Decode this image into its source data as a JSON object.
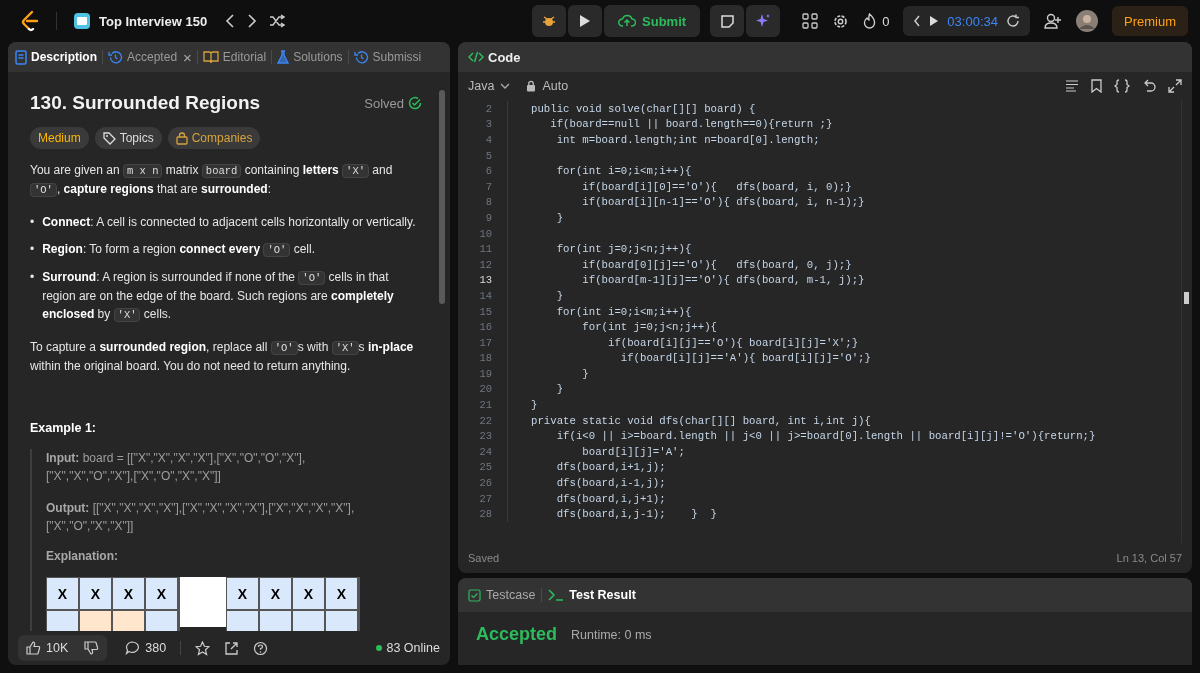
{
  "topbar": {
    "list_title": "Top Interview 150",
    "submit": "Submit",
    "streak": "0",
    "timer": "03:00:34",
    "premium": "Premium"
  },
  "left_tabs": [
    {
      "label": "Description",
      "selected": true,
      "closable": false
    },
    {
      "label": "Accepted",
      "selected": false,
      "closable": true
    },
    {
      "label": "Editorial",
      "selected": false,
      "closable": false
    },
    {
      "label": "Solutions",
      "selected": false,
      "closable": false
    },
    {
      "label": "Submissi",
      "selected": false,
      "closable": false
    }
  ],
  "close_glyph": "×",
  "problem": {
    "title": "130. Surrounded Regions",
    "status": "Solved",
    "tags": [
      {
        "label": "Medium",
        "kind": "difficulty",
        "color": "#ffb800"
      },
      {
        "label": "Topics",
        "kind": "topics",
        "color": "#dddddd"
      },
      {
        "label": "Companies",
        "kind": "companies",
        "color": "#d8a33b"
      }
    ],
    "description": [
      {
        "kind": "paragraph",
        "parts": [
          {
            "kind": "text",
            "text": "You are given an "
          },
          {
            "kind": "code",
            "text": "m x n"
          },
          {
            "kind": "text",
            "text": " matrix "
          },
          {
            "kind": "code",
            "text": "board"
          },
          {
            "kind": "text",
            "text": " containing **letters** "
          },
          {
            "kind": "code",
            "text": "'X'"
          },
          {
            "kind": "text",
            "text": " and "
          },
          {
            "kind": "code",
            "text": "'O'"
          },
          {
            "kind": "text",
            "text": ", **capture regions** that are **surrounded**:"
          }
        ]
      },
      {
        "kind": "bullets",
        "marker": "•",
        "items": [
          {
            "parts": [
              {
                "kind": "text",
                "text": "**Connect**: A cell is connected to adjacent cells horizontally or vertically."
              }
            ]
          },
          {
            "parts": [
              {
                "kind": "text",
                "text": "**Region**: To form a region **connect every** "
              },
              {
                "kind": "code",
                "text": "'O'"
              },
              {
                "kind": "text",
                "text": " cell."
              }
            ]
          },
          {
            "parts": [
              {
                "kind": "text",
                "text": "**Surround**: A region is surrounded if none of the "
              },
              {
                "kind": "code",
                "text": "'O'"
              },
              {
                "kind": "text",
                "text": " cells in that region are on the edge of the board. Such regions are **completely enclosed** by "
              },
              {
                "kind": "code",
                "text": "'X'"
              },
              {
                "kind": "text",
                "text": " cells."
              }
            ]
          }
        ]
      },
      {
        "kind": "paragraph",
        "parts": [
          {
            "kind": "text",
            "text": "To capture a **surrounded region**, replace all "
          },
          {
            "kind": "code",
            "text": "'O'"
          },
          {
            "kind": "text",
            "text": "s with "
          },
          {
            "kind": "code",
            "text": "'X'"
          },
          {
            "kind": "text",
            "text": "s **in-place** within the original board. You do not need to return anything."
          }
        ]
      }
    ],
    "example": {
      "title": "Example 1:",
      "items": [
        {
          "label": "Input:",
          "value": "board = [[\"X\",\"X\",\"X\",\"X\"],[\"X\",\"O\",\"O\",\"X\"],[\"X\",\"X\",\"O\",\"X\"],[\"X\",\"O\",\"X\",\"X\"]]"
        },
        {
          "label": "Output:",
          "value": "[[\"X\",\"X\",\"X\",\"X\"],[\"X\",\"X\",\"X\",\"X\"],[\"X\",\"X\",\"X\",\"X\"],[\"X\",\"O\",\"X\",\"X\"]]"
        }
      ],
      "explanation": "Explanation:",
      "boards": [
        {
          "rows": [
            {
              "cells": [
                {
                  "text": "X",
                  "highlighted": false
                },
                {
                  "text": "X",
                  "highlighted": false
                },
                {
                  "text": "X",
                  "highlighted": false
                },
                {
                  "text": "X",
                  "highlighted": false
                }
              ]
            },
            {
              "cells": [
                {
                  "highlighted": false
                },
                {
                  "highlighted": true
                },
                {
                  "highlighted": true
                },
                {
                  "highlighted": false
                }
              ]
            }
          ]
        },
        {
          "rows": [
            {
              "cells": [
                {
                  "text": "X",
                  "highlighted": false
                },
                {
                  "text": "X",
                  "highlighted": false
                },
                {
                  "text": "X",
                  "highlighted": false
                },
                {
                  "text": "X",
                  "highlighted": false
                }
              ]
            },
            {
              "cells": [
                {
                  "highlighted": false
                },
                {
                  "highlighted": false
                },
                {
                  "highlighted": false
                },
                {
                  "highlighted": false
                }
              ]
            }
          ]
        }
      ]
    }
  },
  "footer": {
    "likes": "10K",
    "comments": "380",
    "online": "83 Online"
  },
  "code_panel": {
    "title": "Code",
    "language": "Java",
    "mode": "Auto",
    "lines": [
      {
        "number": "2",
        "text": "public void solve(char[][] board) {",
        "current": false
      },
      {
        "number": "3",
        "text": "   if(board==null || board.length==0){return ;}",
        "current": false
      },
      {
        "number": "4",
        "text": "    int m=board.length;int n=board[0].length;",
        "current": false
      },
      {
        "number": "5",
        "current": false
      },
      {
        "number": "6",
        "text": "    for(int i=0;i<m;i++){",
        "current": false
      },
      {
        "number": "7",
        "text": "        if(board[i][0]=='O'){   dfs(board, i, 0);}",
        "current": false
      },
      {
        "number": "8",
        "text": "        if(board[i][n-1]=='O'){ dfs(board, i, n-1);}",
        "current": false
      },
      {
        "number": "9",
        "text": "    }",
        "current": false
      },
      {
        "number": "10",
        "current": false
      },
      {
        "number": "11",
        "text": "    for(int j=0;j<n;j++){",
        "current": false
      },
      {
        "number": "12",
        "text": "        if(board[0][j]=='O'){   dfs(board, 0, j);}",
        "current": false
      },
      {
        "number": "13",
        "text": "        if(board[m-1][j]=='O'){ dfs(board, m-1, j);}",
        "current": true
      },
      {
        "number": "14",
        "text": "    }",
        "current": false
      },
      {
        "number": "15",
        "text": "    for(int i=0;i<m;i++){",
        "current": false
      },
      {
        "number": "16",
        "text": "        for(int j=0;j<n;j++){",
        "current": false
      },
      {
        "number": "17",
        "text": "            if(board[i][j]=='O'){ board[i][j]='X';}",
        "current": false
      },
      {
        "number": "18",
        "text": "              if(board[i][j]=='A'){ board[i][j]='O';}",
        "current": false
      },
      {
        "number": "19",
        "text": "        }",
        "current": false
      },
      {
        "number": "20",
        "text": "    }",
        "current": false
      },
      {
        "number": "21",
        "text": "}",
        "current": false
      },
      {
        "number": "22",
        "text": "private static void dfs(char[][] board, int i,int j){",
        "current": false
      },
      {
        "number": "23",
        "text": "    if(i<0 || i>=board.length || j<0 || j>=board[0].length || board[i][j]!='O'){return;}",
        "current": false
      },
      {
        "number": "24",
        "text": "        board[i][j]='A';",
        "current": false
      },
      {
        "number": "25",
        "text": "    dfs(board,i+1,j);",
        "current": false
      },
      {
        "number": "26",
        "text": "    dfs(board,i-1,j);",
        "current": false
      },
      {
        "number": "27",
        "text": "    dfs(board,i,j+1);",
        "current": false
      },
      {
        "number": "28",
        "text": "    dfs(board,i,j-1);    }  }",
        "current": false
      }
    ],
    "saved": "Saved",
    "cursor": "Ln 13, Col 57"
  },
  "result_panel": {
    "tabs": [
      {
        "label": "Testcase",
        "selected": false
      },
      {
        "label": "Test Result",
        "selected": true
      }
    ],
    "verdict": "Accepted",
    "runtime": "Runtime: 0 ms"
  }
}
